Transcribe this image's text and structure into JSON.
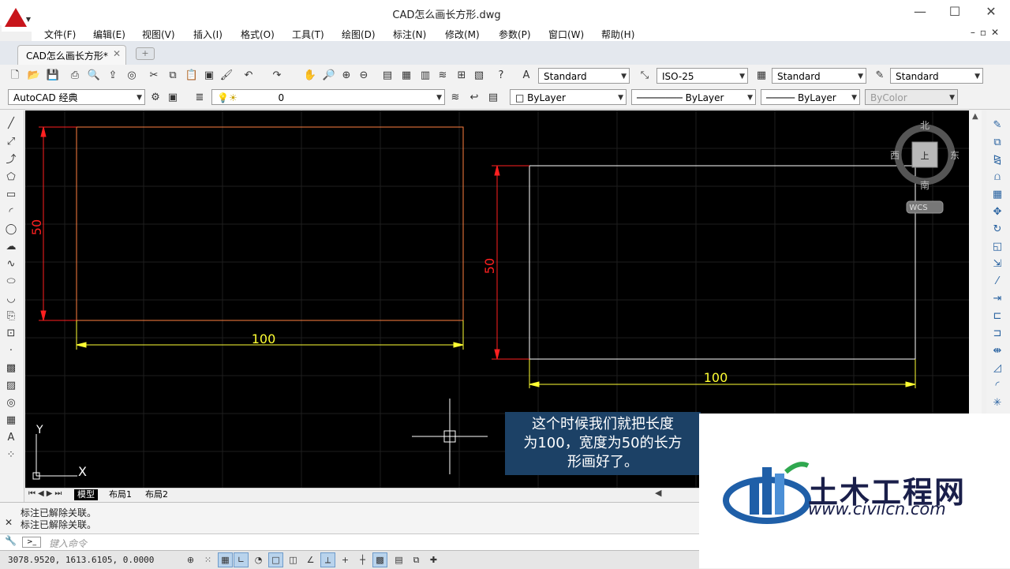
{
  "window": {
    "title": "CAD怎么画长方形.dwg",
    "minimize_label": "—",
    "maximize_label": "☐",
    "close_label": "✕"
  },
  "menu": {
    "items": [
      "文件(F)",
      "编辑(E)",
      "视图(V)",
      "插入(I)",
      "格式(O)",
      "工具(T)",
      "绘图(D)",
      "标注(N)",
      "修改(M)",
      "参数(P)",
      "窗口(W)",
      "帮助(H)"
    ],
    "mdi_buttons": "–▫✕"
  },
  "tabs": {
    "document": "CAD怎么画长方形*",
    "close": "✕",
    "new": "+"
  },
  "toolbar1": {
    "text_style": "Standard",
    "dim_style": "ISO-25",
    "table_style": "Standard",
    "multileader_style": "Standard"
  },
  "toolbar2": {
    "workspace": "AutoCAD 经典",
    "layer": "0",
    "color": "ByLayer",
    "linetype": "ByLayer",
    "lineweight": "ByLayer",
    "plotstyle": "ByColor"
  },
  "drawing": {
    "left_rect": {
      "width_dim": "100",
      "height_dim": "50"
    },
    "right_rect": {
      "width_dim": "100",
      "height_dim": "50"
    },
    "axis_y": "Y",
    "axis_x": "X"
  },
  "viewcube": {
    "north": "北",
    "south": "南",
    "west": "西",
    "east": "东",
    "top": "上",
    "wcs": "WCS"
  },
  "layout_tabs": {
    "model": "模型",
    "layout1": "布局1",
    "layout2": "布局2"
  },
  "command": {
    "history": [
      "标注已解除关联。",
      "标注已解除关联。"
    ],
    "placeholder": "键入命令",
    "close": "✕"
  },
  "status": {
    "coords": "3078.9520, 1613.6105, 0.0000"
  },
  "subtitle": {
    "lines": [
      "这个时候我们就把长度",
      "为100，宽度为50的长方",
      "形画好了。"
    ]
  },
  "watermark": {
    "name": "土木工程网",
    "url": "www.civilcn.com"
  },
  "colors": {
    "canvas_bg": "#000000",
    "left_rect": "#ff8040",
    "right_rect": "#ffffff",
    "dim_line_vertical": "#ff0000",
    "dim_line_horizontal": "#ffff00",
    "subtitle_bg": "#1c4166"
  }
}
